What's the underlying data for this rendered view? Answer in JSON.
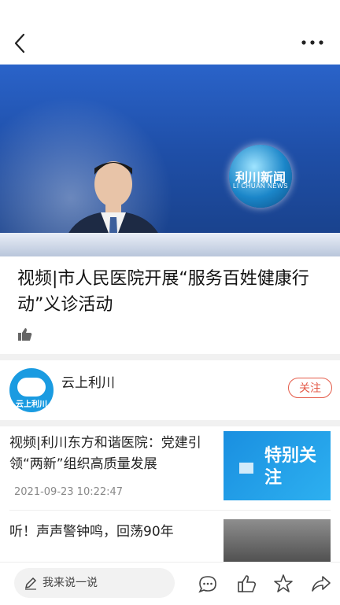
{
  "article": {
    "title": "视频|市人民医院开展“服务百姓健康行动”义诊活动",
    "video_logo": "利川新闻",
    "video_logo_sub": "LI CHUAN NEWS"
  },
  "publisher": {
    "name": "云上利川",
    "avatar_label": "云上利川",
    "follow_label": "关注"
  },
  "related": [
    {
      "title": "视频|利川东方和谐医院：党建引领“两新”组织高质量发展",
      "date": "2021-09-23 10:22:47",
      "thumb_text": "特别关注"
    },
    {
      "title": "听！声声警钟鸣，回荡90年"
    }
  ],
  "bottom": {
    "comment_placeholder": "我来说一说"
  },
  "icons": {
    "back": "back-arrow-icon",
    "more": "more-dots-icon",
    "like": "thumbs-up-icon",
    "comment": "comment-icon",
    "star": "star-icon",
    "share": "share-icon"
  }
}
